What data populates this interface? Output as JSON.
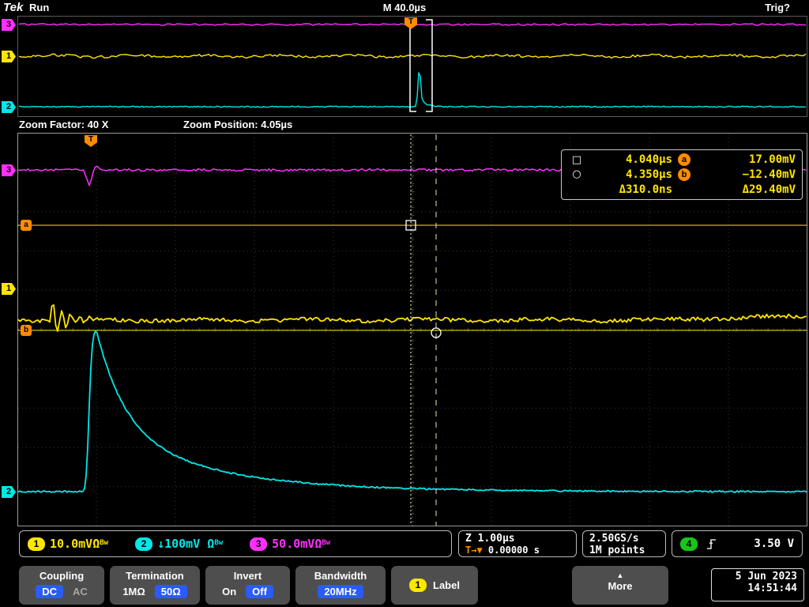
{
  "header": {
    "logo": "Tek",
    "acq_status": "Run",
    "timebase": "M 40.0µs",
    "trigger_status": "Trig?"
  },
  "zoom": {
    "factor": "Zoom Factor: 40 X",
    "position": "Zoom Position: 4.05µs"
  },
  "markers": {
    "trigger": "T",
    "ch1": "1",
    "ch2": "2",
    "ch3": "3",
    "cursor_a": "a",
    "cursor_b": "b"
  },
  "cursor_readout": {
    "row1": {
      "symbol": "□",
      "time": "4.040µs",
      "badge": "a",
      "value": "17.00mV"
    },
    "row2": {
      "symbol": "○",
      "time": "4.350µs",
      "badge": "b",
      "value": "−12.40mV"
    },
    "row3": {
      "time": "Δ310.0ns",
      "value": "Δ29.40mV"
    }
  },
  "channel_readouts": {
    "ch1": {
      "badge": "1",
      "scale": "10.0mV",
      "unit": "Ω",
      "bw": "Bw"
    },
    "ch2": {
      "badge": "2",
      "scale": "↓100mV",
      "unit": "Ω",
      "bw": "Bw"
    },
    "ch3": {
      "badge": "3",
      "scale": "50.0mV",
      "unit": "Ω",
      "bw": "Bw"
    }
  },
  "horizontal_readout": {
    "zoom_scale": "Z 1.00µs",
    "trig_icon": "T→▼",
    "delay": "0.00000 s",
    "sample_rate": "2.50GS/s",
    "record_length": "1M points"
  },
  "trigger_readout": {
    "source_badge": "4",
    "level": "3.50 V"
  },
  "menu": {
    "coupling": {
      "title": "Coupling",
      "opt1": "DC",
      "opt2": "AC"
    },
    "termination": {
      "title": "Termination",
      "opt1": "1MΩ",
      "opt2": "50Ω"
    },
    "invert": {
      "title": "Invert",
      "opt1": "On",
      "opt2": "Off"
    },
    "bandwidth": {
      "title": "Bandwidth",
      "value": "20MHz"
    },
    "label": {
      "badge": "1",
      "title": "Label"
    },
    "more": {
      "arrow": "▲",
      "title": "More"
    }
  },
  "datetime": {
    "date": "5 Jun 2023",
    "time": "14:51:44"
  },
  "colors": {
    "ch1": "#ffe600",
    "ch2": "#00e8e8",
    "ch3": "#ff30ff",
    "ch4": "#17c617",
    "cursor_marker": "#ff8c00",
    "menu_highlight": "#2b5bff"
  }
}
